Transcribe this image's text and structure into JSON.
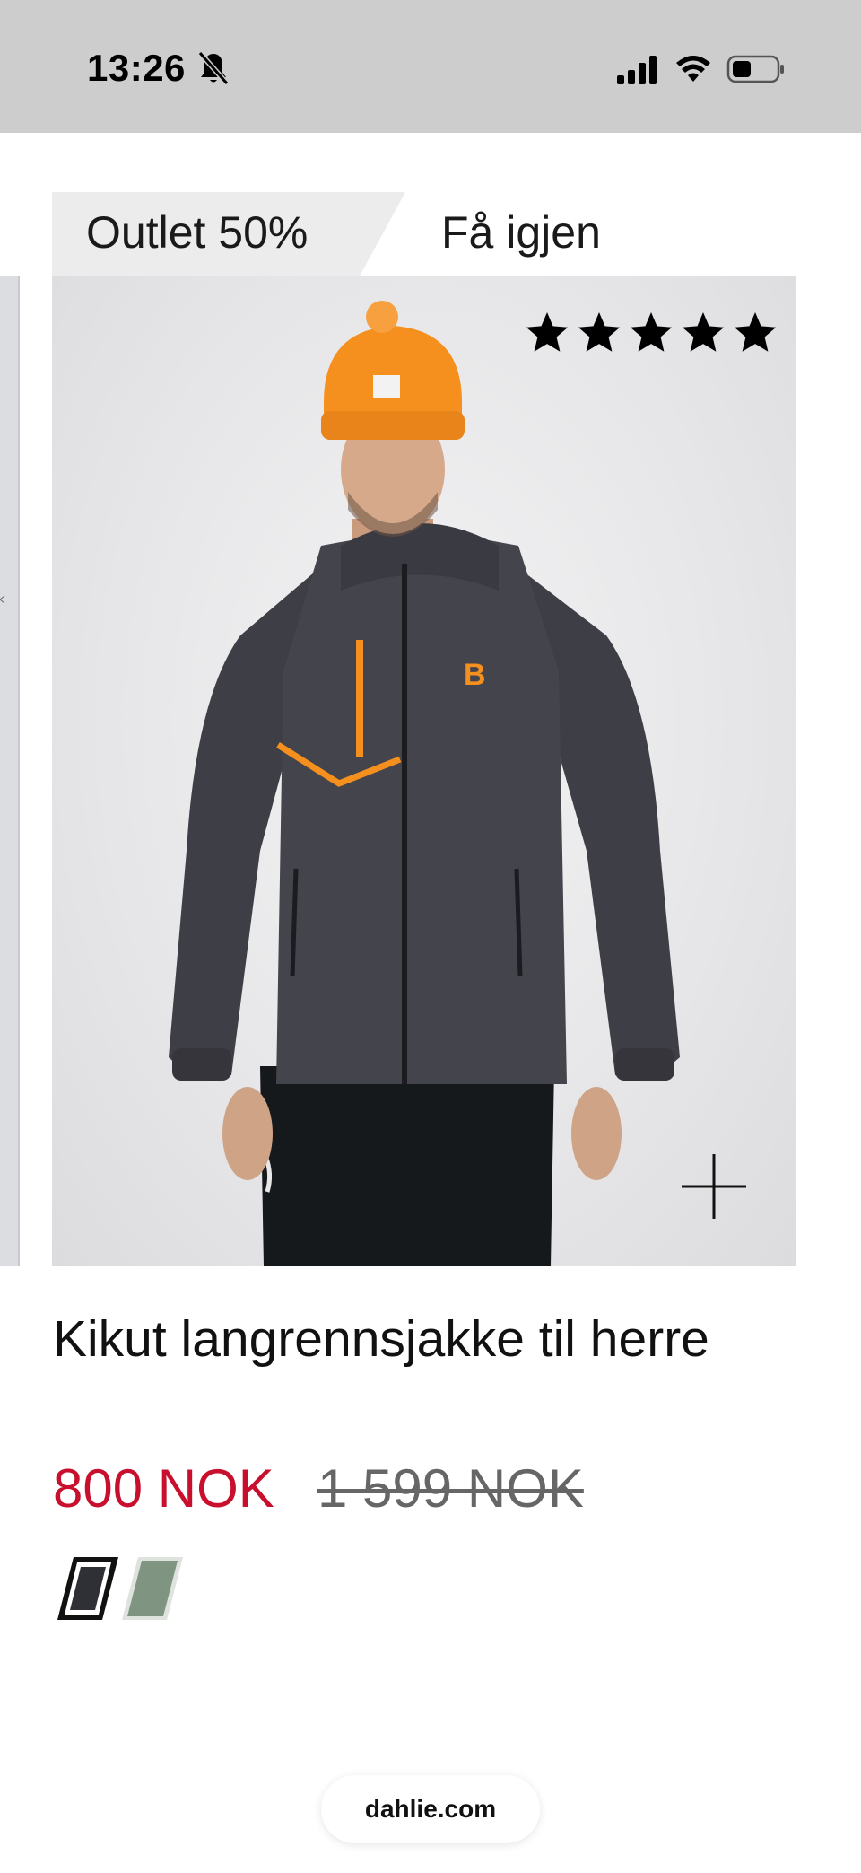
{
  "status_bar": {
    "time": "13:26",
    "icons": [
      "bell-slash-icon",
      "signal-icon",
      "wifi-icon",
      "battery-icon"
    ]
  },
  "product": {
    "tags": {
      "outlet": "Outlet 50%",
      "restock": "Få igjen"
    },
    "rating": 5,
    "title": "Kikut langrennsjakke til herre",
    "price_sale": "800 NOK",
    "price_original": "1 599 NOK",
    "swatches": [
      {
        "color": "#2f2f36",
        "selected": true
      },
      {
        "color": "#7f9582",
        "selected": false
      }
    ]
  },
  "browser": {
    "url": "dahlie.com"
  },
  "colors": {
    "sale_red": "#c8102e",
    "jacket_gray": "#3e3e46",
    "accent_orange": "#f5901e"
  }
}
